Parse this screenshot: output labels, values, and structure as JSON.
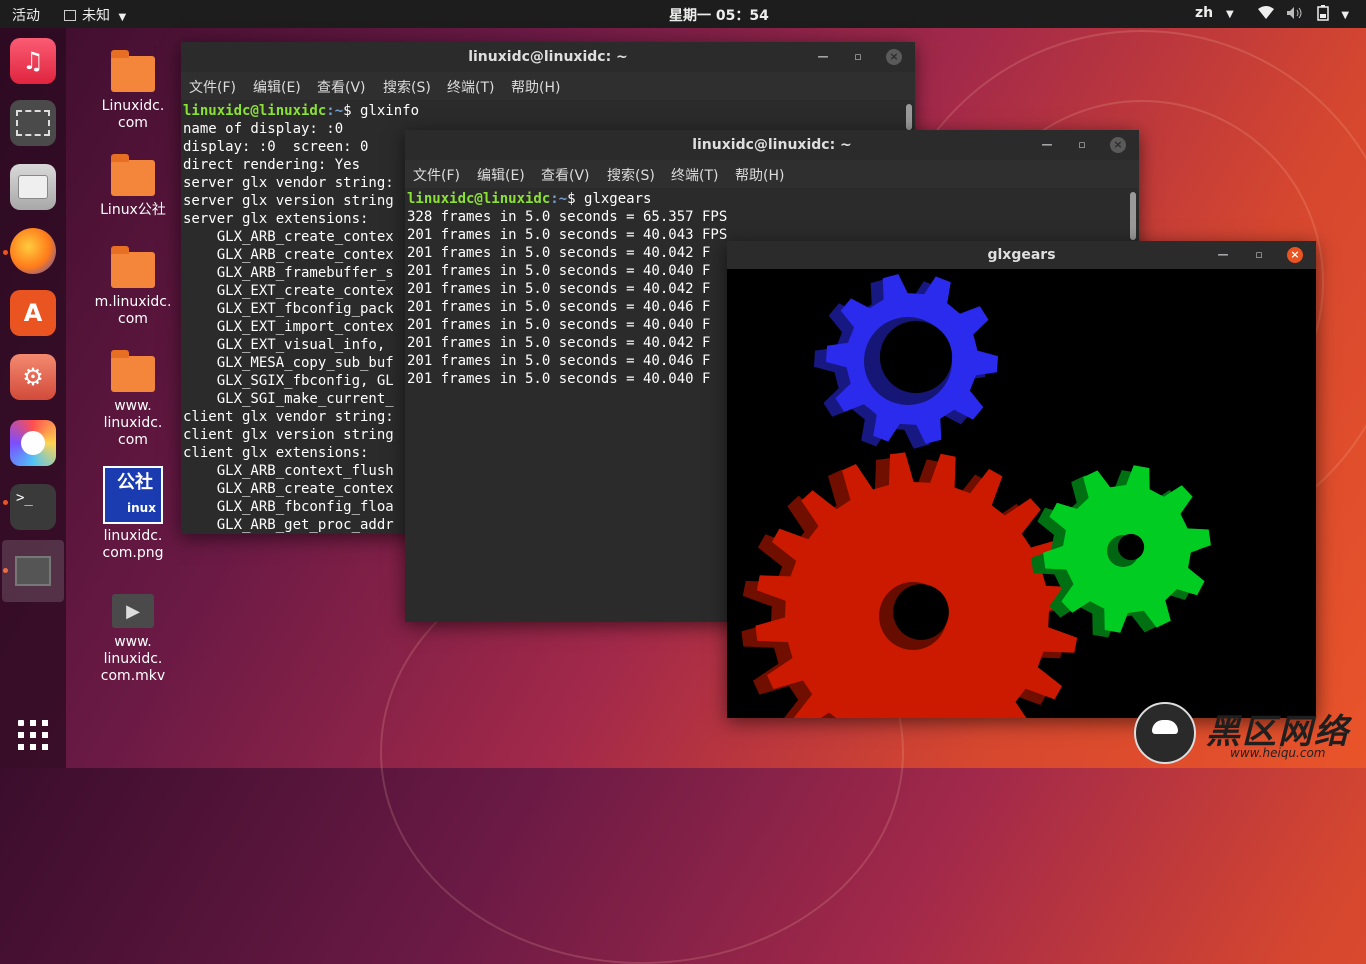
{
  "topbar": {
    "activities": "活动",
    "app_menu": "未知",
    "clock": "星期一 05：54",
    "language": "zh",
    "indicator_icons": [
      "network-icon",
      "volume-icon",
      "battery-icon"
    ]
  },
  "dock": {
    "apps": [
      "music-icon",
      "screenshot-icon",
      "files-icon",
      "firefox-icon",
      "software-center-icon",
      "settings-icon",
      "help-icon",
      "terminal-icon",
      "window-icon"
    ],
    "show_apps_icon": "grid-icon"
  },
  "desktop": {
    "icons": [
      {
        "label": "Linuxidc.\ncom",
        "kind": "folder"
      },
      {
        "label": "Linux公社",
        "kind": "folder"
      },
      {
        "label": "m.linuxidc.\ncom",
        "kind": "folder"
      },
      {
        "label": "www.\nlinuxidc.\ncom",
        "kind": "folder"
      },
      {
        "label": "linuxidc.\ncom.png",
        "kind": "image"
      },
      {
        "label": "www.\nlinuxidc.\ncom.mkv",
        "kind": "video"
      }
    ],
    "png_thumb_text": "公社",
    "png_thumb_sub": "inux"
  },
  "terminal1": {
    "title": "linuxidc@linuxidc: ~",
    "menu": [
      "文件(F)",
      "编辑(E)",
      "查看(V)",
      "搜索(S)",
      "终端(T)",
      "帮助(H)"
    ],
    "prompt_user": "linuxidc@linuxidc",
    "prompt_path": ":~",
    "prompt_suffix": "$ glxinfo",
    "lines": [
      "name of display: :0",
      "display: :0  screen: 0",
      "direct rendering: Yes",
      "server glx vendor string:",
      "server glx version string",
      "server glx extensions:",
      "    GLX_ARB_create_contex",
      "    GLX_ARB_create_contex",
      "    GLX_ARB_framebuffer_s",
      "    GLX_EXT_create_contex",
      "    GLX_EXT_fbconfig_pack",
      "    GLX_EXT_import_contex",
      "    GLX_EXT_visual_info,",
      "    GLX_MESA_copy_sub_buf",
      "    GLX_SGIX_fbconfig, GL",
      "    GLX_SGI_make_current_",
      "client glx vendor string:",
      "client glx version string",
      "client glx extensions:",
      "    GLX_ARB_context_flush",
      "    GLX_ARB_create_contex",
      "    GLX_ARB_fbconfig_floa",
      "    GLX_ARB_get_proc_addr"
    ]
  },
  "terminal2": {
    "title": "linuxidc@linuxidc: ~",
    "menu": [
      "文件(F)",
      "编辑(E)",
      "查看(V)",
      "搜索(S)",
      "终端(T)",
      "帮助(H)"
    ],
    "prompt_user": "linuxidc@linuxidc",
    "prompt_path": ":~",
    "prompt_suffix": "$ glxgears",
    "lines": [
      "328 frames in 5.0 seconds = 65.357 FPS",
      "201 frames in 5.0 seconds = 40.043 FPS",
      "201 frames in 5.0 seconds = 40.042 F",
      "201 frames in 5.0 seconds = 40.040 F",
      "201 frames in 5.0 seconds = 40.042 F",
      "201 frames in 5.0 seconds = 40.046 F",
      "201 frames in 5.0 seconds = 40.040 F",
      "201 frames in 5.0 seconds = 40.042 F",
      "201 frames in 5.0 seconds = 40.046 F",
      "201 frames in 5.0 seconds = 40.040 F"
    ]
  },
  "glxgears": {
    "title": "glxgears",
    "gears": [
      {
        "color": "#cc1a00",
        "teeth": 20
      },
      {
        "color": "#00cc22",
        "teeth": 10
      },
      {
        "color": "#2b2bee",
        "teeth": 10
      }
    ]
  },
  "watermark": {
    "text": "黑区网络",
    "url": "www.heiqu.com"
  },
  "colors": {
    "accent": "#e95420",
    "prompt_user": "#8ae234",
    "prompt_path": "#729fcf"
  }
}
